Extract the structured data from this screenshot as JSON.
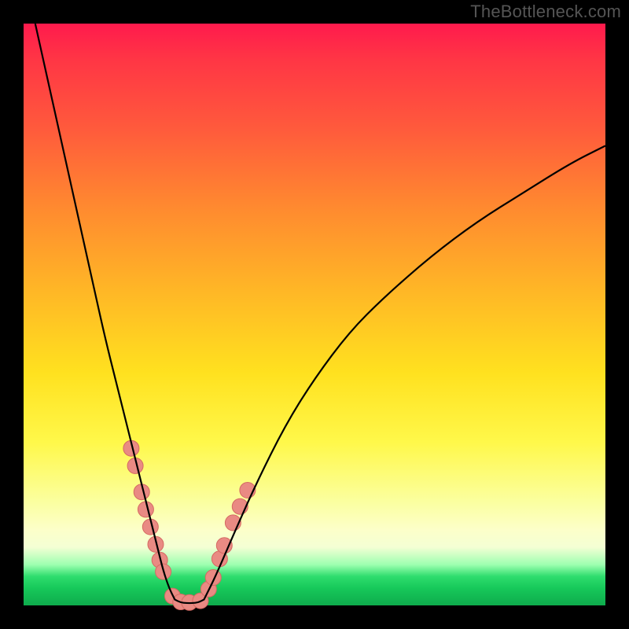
{
  "watermark": "TheBottleneck.com",
  "chart_data": {
    "type": "line",
    "title": "",
    "xlabel": "",
    "ylabel": "",
    "xlim": [
      0,
      100
    ],
    "ylim": [
      0,
      100
    ],
    "grid": false,
    "legend": false,
    "series": [
      {
        "name": "bottleneck-curve-left",
        "x": [
          2,
          4,
          6,
          8,
          10,
          12,
          14,
          16,
          18,
          20,
          21,
          22,
          23,
          24,
          25,
          26
        ],
        "y": [
          100,
          91,
          82,
          73,
          64,
          55,
          46,
          38,
          30,
          22,
          18,
          14,
          10,
          6,
          3,
          1
        ]
      },
      {
        "name": "bottleneck-curve-bottom",
        "x": [
          26,
          27,
          28,
          29,
          30,
          31
        ],
        "y": [
          1,
          0.5,
          0.4,
          0.4,
          0.5,
          1
        ]
      },
      {
        "name": "bottleneck-curve-right",
        "x": [
          31,
          33,
          36,
          40,
          45,
          50,
          56,
          62,
          70,
          78,
          86,
          94,
          100
        ],
        "y": [
          1,
          5,
          12,
          21,
          31,
          39,
          47,
          53,
          60,
          66,
          71,
          76,
          79
        ]
      }
    ],
    "markers": [
      {
        "x": 18.5,
        "y": 27
      },
      {
        "x": 19.2,
        "y": 24
      },
      {
        "x": 20.3,
        "y": 19.5
      },
      {
        "x": 21.0,
        "y": 16.5
      },
      {
        "x": 21.8,
        "y": 13.5
      },
      {
        "x": 22.7,
        "y": 10.5
      },
      {
        "x": 23.4,
        "y": 7.8
      },
      {
        "x": 24.0,
        "y": 5.8
      },
      {
        "x": 25.6,
        "y": 1.6
      },
      {
        "x": 27.0,
        "y": 0.6
      },
      {
        "x": 28.5,
        "y": 0.5
      },
      {
        "x": 30.4,
        "y": 0.8
      },
      {
        "x": 31.8,
        "y": 2.8
      },
      {
        "x": 32.6,
        "y": 4.8
      },
      {
        "x": 33.7,
        "y": 8.0
      },
      {
        "x": 34.5,
        "y": 10.3
      },
      {
        "x": 36.0,
        "y": 14.2
      },
      {
        "x": 37.2,
        "y": 17.0
      },
      {
        "x": 38.5,
        "y": 19.8
      }
    ],
    "marker_style": {
      "fill": "#e98a83",
      "stroke": "#d56a63",
      "r": 10
    },
    "line_style": {
      "stroke": "#000000",
      "width": 2.2
    }
  }
}
